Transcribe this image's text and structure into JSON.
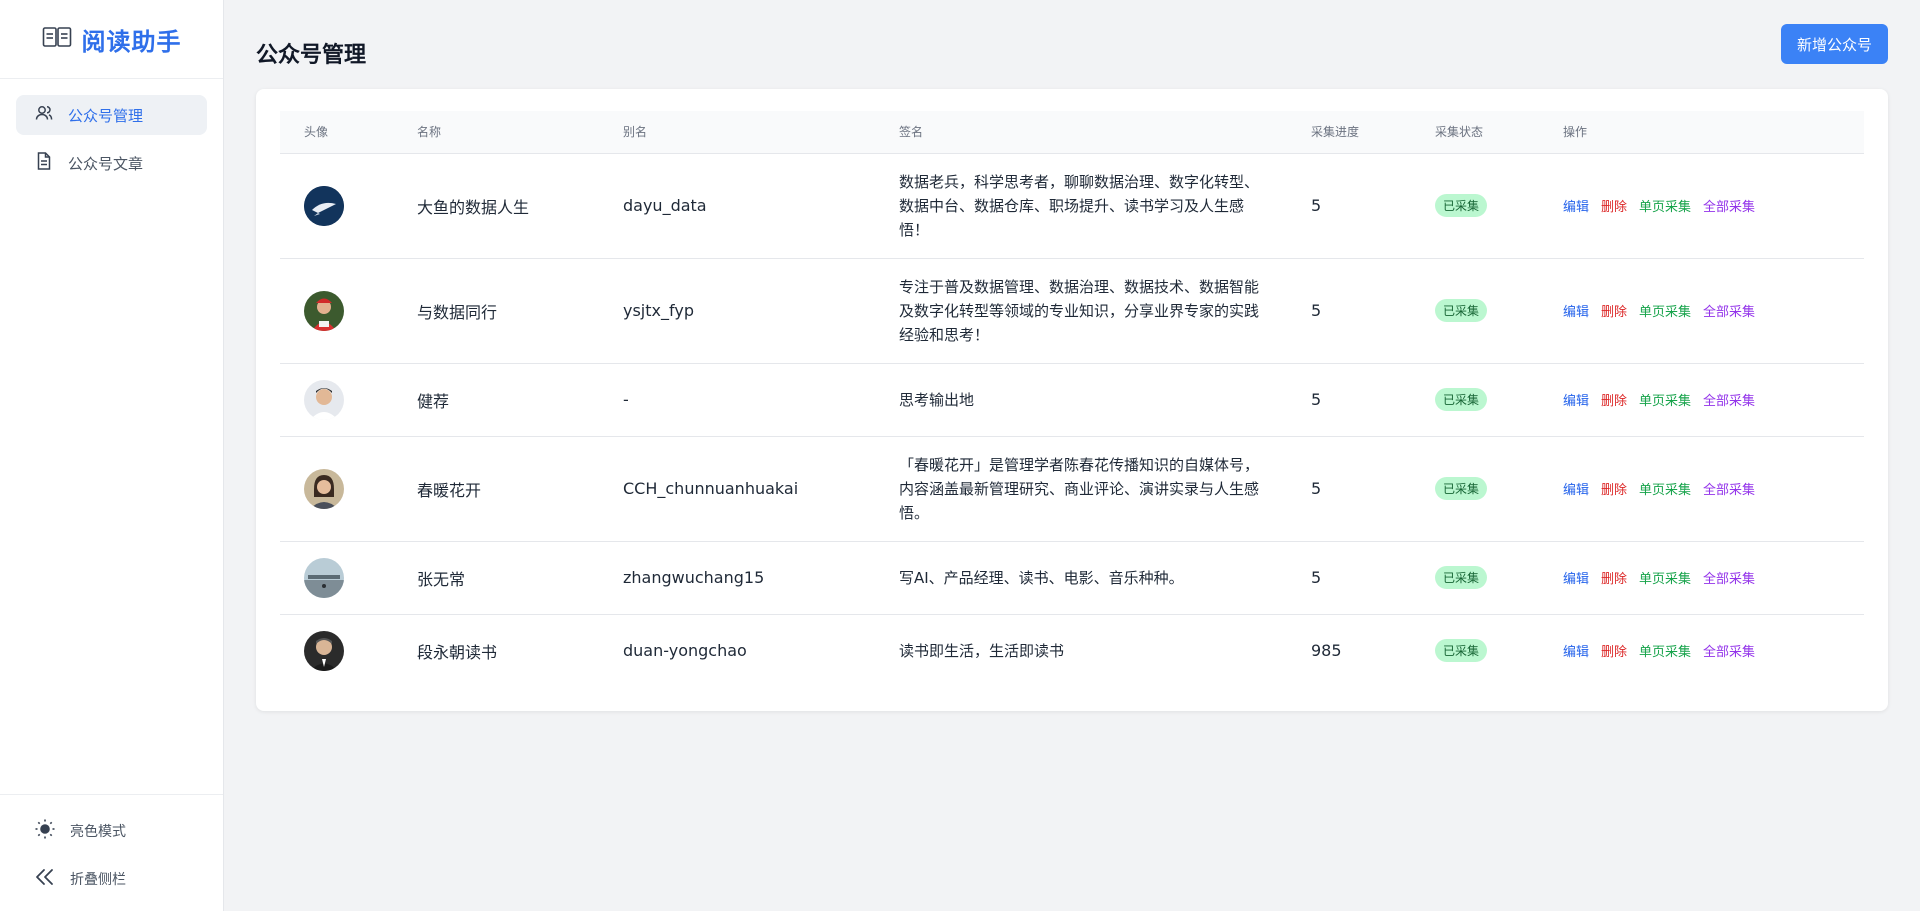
{
  "app": {
    "title": "阅读助手",
    "brand_color": "#2f6fea"
  },
  "sidebar": {
    "items": [
      {
        "label": "公众号管理",
        "icon": "users-icon",
        "active": true
      },
      {
        "label": "公众号文章",
        "icon": "document-icon",
        "active": false
      }
    ],
    "bottom": [
      {
        "label": "亮色模式",
        "icon": "sun-icon"
      },
      {
        "label": "折叠侧栏",
        "icon": "collapse-icon"
      }
    ]
  },
  "page": {
    "title": "公众号管理",
    "add_button_label": "新增公众号"
  },
  "table": {
    "headers": [
      "头像",
      "名称",
      "别名",
      "签名",
      "采集进度",
      "采集状态",
      "操作"
    ],
    "actions": {
      "edit": "编辑",
      "delete": "删除",
      "single": "单页采集",
      "all": "全部采集"
    },
    "rows": [
      {
        "avatar": "avatar-1",
        "name": "大鱼的数据人生",
        "alias": "dayu_data",
        "signature": "数据老兵，科学思考者，聊聊数据治理、数字化转型、数据中台、数据仓库、职场提升、读书学习及人生感悟！",
        "progress": "5",
        "status": "已采集"
      },
      {
        "avatar": "avatar-2",
        "name": "与数据同行",
        "alias": "ysjtx_fyp",
        "signature": "专注于普及数据管理、数据治理、数据技术、数据智能及数字化转型等领域的专业知识，分享业界专家的实践经验和思考！",
        "progress": "5",
        "status": "已采集"
      },
      {
        "avatar": "avatar-3",
        "name": "健荐",
        "alias": "-",
        "signature": "思考输出地",
        "progress": "5",
        "status": "已采集"
      },
      {
        "avatar": "avatar-4",
        "name": "春暖花开",
        "alias": "CCH_chunnuanhuakai",
        "signature": "「春暖花开」是管理学者陈春花传播知识的自媒体号，内容涵盖最新管理研究、商业评论、演讲实录与人生感悟。",
        "progress": "5",
        "status": "已采集"
      },
      {
        "avatar": "avatar-5",
        "name": "张无常",
        "alias": "zhangwuchang15",
        "signature": "写AI、产品经理、读书、电影、音乐种种。",
        "progress": "5",
        "status": "已采集"
      },
      {
        "avatar": "avatar-6",
        "name": "段永朝读书",
        "alias": "duan-yongchao",
        "signature": "读书即生活，生活即读书",
        "progress": "985",
        "status": "已采集"
      }
    ]
  },
  "colors": {
    "primary": "#3b82f6",
    "edit": "#2563eb",
    "delete": "#dc2626",
    "single": "#16a34a",
    "all": "#9333ea",
    "status_bg": "#bbf7d0"
  }
}
